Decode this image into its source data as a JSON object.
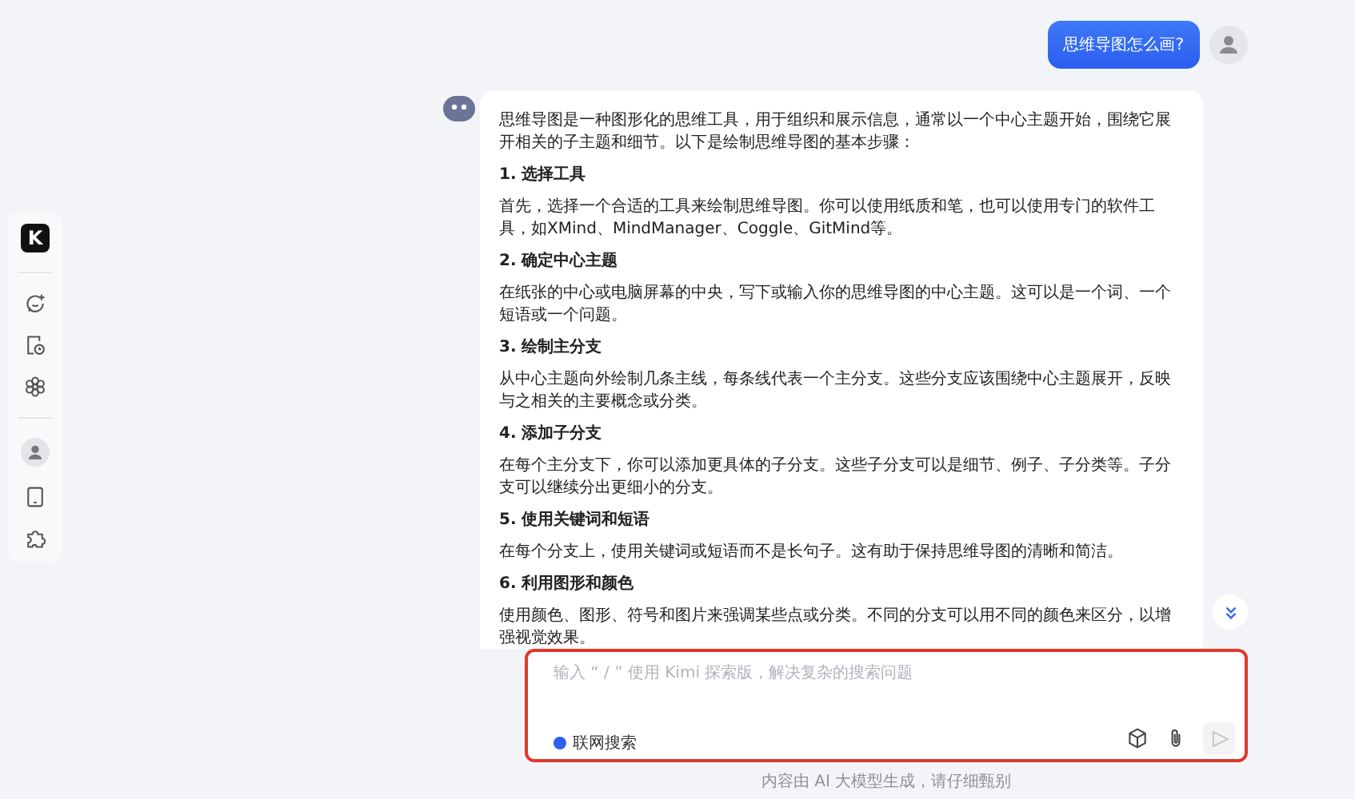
{
  "sidebar": {
    "logo": "K"
  },
  "messages": [
    {
      "kind": "user",
      "text": "思维导图怎么画?"
    },
    {
      "kind": "assistant",
      "blocks": [
        {
          "kind": "paragraph",
          "text": "思维导图是一种图形化的思维工具，用于组织和展示信息，通常以一个中心主题开始，围绕它展开相关的子主题和细节。以下是绘制思维导图的基本步骤："
        },
        {
          "kind": "heading",
          "text": "1. 选择工具"
        },
        {
          "kind": "paragraph",
          "text": "首先，选择一个合适的工具来绘制思维导图。你可以使用纸质和笔，也可以使用专门的软件工具，如XMind、MindManager、Coggle、GitMind等。"
        },
        {
          "kind": "heading",
          "text": "2. 确定中心主题"
        },
        {
          "kind": "paragraph",
          "text": "在纸张的中心或电脑屏幕的中央，写下或输入你的思维导图的中心主题。这可以是一个词、一个短语或一个问题。"
        },
        {
          "kind": "heading",
          "text": "3. 绘制主分支"
        },
        {
          "kind": "paragraph",
          "text": "从中心主题向外绘制几条主线，每条线代表一个主分支。这些分支应该围绕中心主题展开，反映与之相关的主要概念或分类。"
        },
        {
          "kind": "heading",
          "text": "4. 添加子分支"
        },
        {
          "kind": "paragraph",
          "text": "在每个主分支下，你可以添加更具体的子分支。这些子分支可以是细节、例子、子分类等。子分支可以继续分出更细小的分支。"
        },
        {
          "kind": "heading",
          "text": "5. 使用关键词和短语"
        },
        {
          "kind": "paragraph",
          "text": "在每个分支上，使用关键词或短语而不是长句子。这有助于保持思维导图的清晰和简洁。"
        },
        {
          "kind": "heading",
          "text": "6. 利用图形和颜色"
        },
        {
          "kind": "paragraph",
          "text": "使用颜色、图形、符号和图片来强调某些点或分类。不同的分支可以用不同的颜色来区分，以增强视觉效果。"
        }
      ]
    }
  ],
  "input": {
    "placeholder": "输入 “ / ” 使用 Kimi 探索版，解决复杂的搜索问题",
    "web_search": {
      "label": "联网搜索",
      "on": true
    },
    "send_disabled": true
  },
  "footer": "内容由 AI 大模型生成，请仔细甄别"
}
